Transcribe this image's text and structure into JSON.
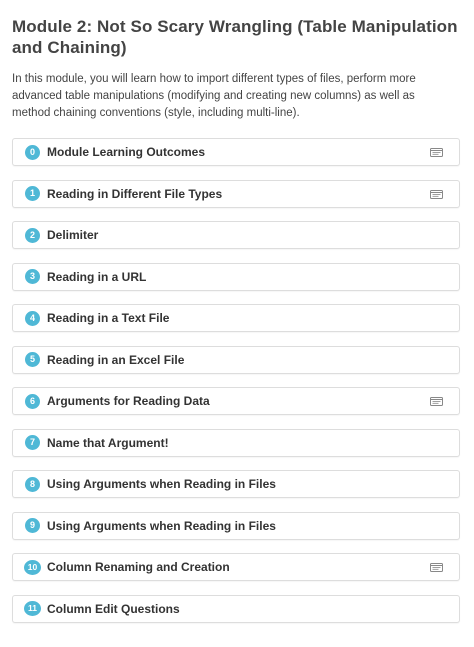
{
  "module": {
    "title": "Module 2: Not So Scary Wrangling (Table Manipulation and Chaining)",
    "description": "In this module, you will learn how to import different types of files, perform more advanced table manipulations (modifying and creating new columns) as well as method chaining conventions (style, including multi-line)."
  },
  "lessons": [
    {
      "number": "0",
      "label": "Module Learning Outcomes",
      "icon": "slides-icon"
    },
    {
      "number": "1",
      "label": "Reading in Different File Types",
      "icon": "slides-icon"
    },
    {
      "number": "2",
      "label": "Delimiter",
      "icon": ""
    },
    {
      "number": "3",
      "label": "Reading in a URL",
      "icon": ""
    },
    {
      "number": "4",
      "label": "Reading in a Text File",
      "icon": ""
    },
    {
      "number": "5",
      "label": "Reading in an Excel File",
      "icon": ""
    },
    {
      "number": "6",
      "label": "Arguments for Reading Data",
      "icon": "slides-icon"
    },
    {
      "number": "7",
      "label": "Name that Argument!",
      "icon": ""
    },
    {
      "number": "8",
      "label": "Using Arguments when Reading in Files",
      "icon": ""
    },
    {
      "number": "9",
      "label": "Using Arguments when Reading in Files",
      "icon": ""
    },
    {
      "number": "10",
      "label": "Column Renaming and Creation",
      "icon": "slides-icon"
    },
    {
      "number": "11",
      "label": "Column Edit Questions",
      "icon": ""
    }
  ],
  "colors": {
    "badge": "#4fb8d6",
    "border": "#dddddd",
    "text": "#333333"
  }
}
